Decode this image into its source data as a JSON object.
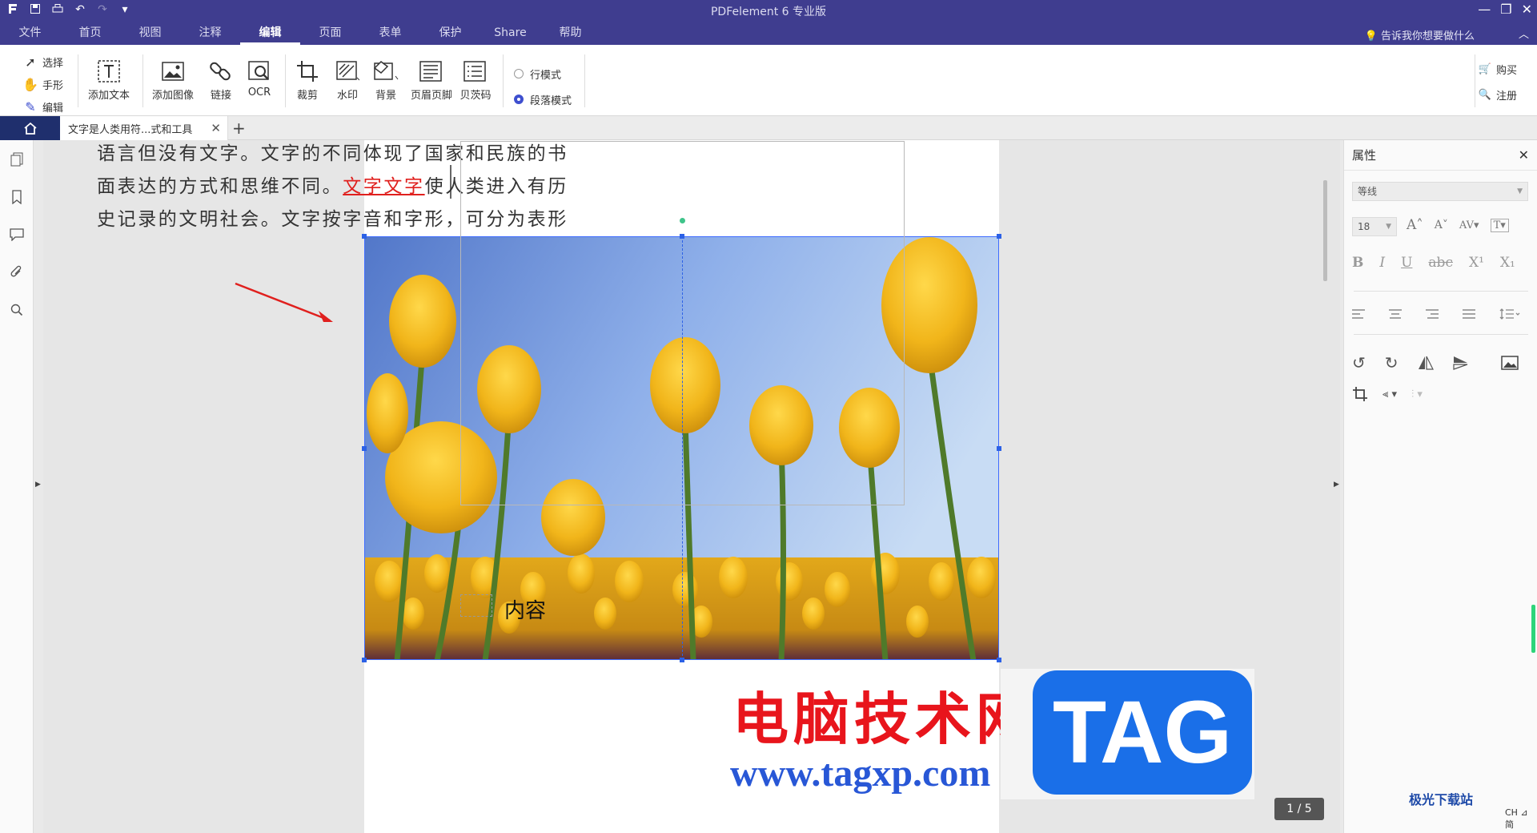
{
  "quick_access": [
    "logo-icon",
    "save-icon",
    "print-icon",
    "undo-icon",
    "redo-icon",
    "customize-icon"
  ],
  "app_title": "PDFelement 6 专业版",
  "menu": [
    "文件",
    "首页",
    "视图",
    "注释",
    "编辑",
    "页面",
    "表单",
    "保护",
    "Share",
    "帮助"
  ],
  "active_menu": "编辑",
  "tell_me": "告诉我你想要做什么",
  "ribbon": {
    "modes": [
      "选择",
      "手形",
      "编辑"
    ],
    "tools": [
      "添加文本",
      "添加图像",
      "链接",
      "OCR",
      "裁剪",
      "水印",
      "背景",
      "页眉页脚",
      "贝茨码"
    ],
    "radio": [
      "行模式",
      "段落模式"
    ],
    "selected_radio": "段落模式",
    "buy": "购买",
    "register": "注册"
  },
  "tab": {
    "title": "文字是人类用符...式和工具"
  },
  "document": {
    "line1": "语言但没有文字。文字的不同体现了国家和民族的书",
    "line2_before": "面表达的方式和思维不同。",
    "line2_red": "文字文字",
    "line2_after": "使人类进入有历",
    "line3": "史记录的文明社会。文字按字音和字形，可分为表形",
    "content_label": "内容"
  },
  "page_indicator": "1 / 5",
  "properties": {
    "title": "属性",
    "font": "等线",
    "size": "18",
    "format_buttons": [
      "B",
      "I",
      "U",
      "abc",
      "X¹",
      "X₁"
    ]
  },
  "watermark": {
    "cn": "电脑技术网",
    "url": "www.tagxp.com",
    "tag": "TAG",
    "brand": "极光下载站",
    "brand_sub": "CH ⊿ 简"
  },
  "colors": {
    "titlebar": "#3f3d8f",
    "accent": "#3e4fcf",
    "selection": "#2c61e6",
    "red_text": "#e0201e"
  }
}
